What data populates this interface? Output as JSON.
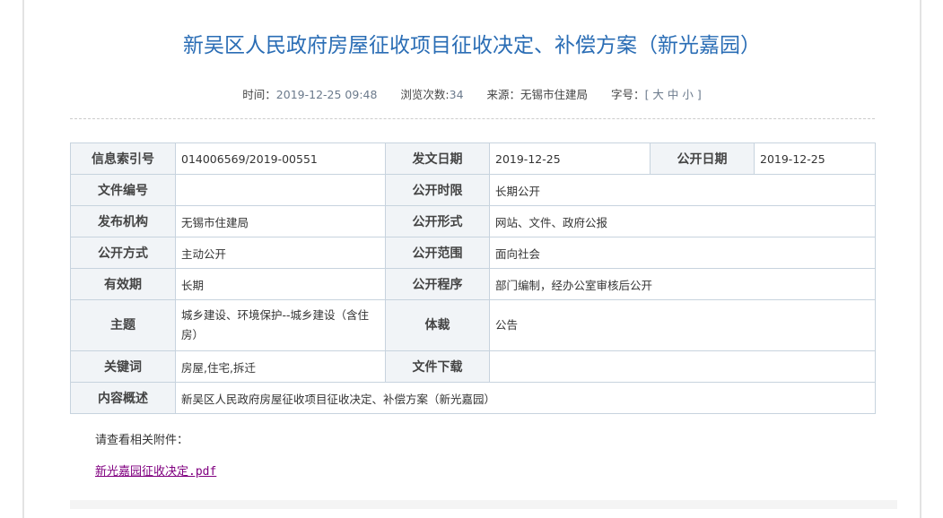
{
  "title": "新吴区人民政府房屋征收项目征收决定、补偿方案（新光嘉园）",
  "meta": {
    "time_label": "时间：",
    "time": "2019-12-25 09:48",
    "views_label": "浏览次数:",
    "views": "34",
    "source_label": "来源：",
    "source": "无锡市住建局",
    "font_label": "字号：",
    "font_sizes": "[ 大 中 小 ]"
  },
  "table": {
    "r0": [
      "信息索引号",
      "014006569/2019-00551",
      "发文日期",
      "2019-12-25",
      "公开日期",
      "2019-12-25"
    ],
    "r1": [
      "文件编号",
      "",
      "公开时限",
      "长期公开"
    ],
    "r2": [
      "发布机构",
      "无锡市住建局",
      "公开形式",
      "网站、文件、政府公报"
    ],
    "r3": [
      "公开方式",
      "主动公开",
      "公开范围",
      "面向社会"
    ],
    "r4": [
      "有效期",
      "长期",
      "公开程序",
      "部门编制，经办公室审核后公开"
    ],
    "r5": [
      "主题",
      "城乡建设、环境保护--城乡建设（含住房）",
      "体裁",
      "公告"
    ],
    "r6": [
      "关键词",
      "房屋,住宅,拆迁",
      "文件下载",
      ""
    ],
    "r7": [
      "内容概述",
      "新吴区人民政府房屋征收项目征收决定、补偿方案（新光嘉园）"
    ]
  },
  "attachments_hint": "请查看相关附件：",
  "attachment": "新光嘉园征收决定.pdf"
}
